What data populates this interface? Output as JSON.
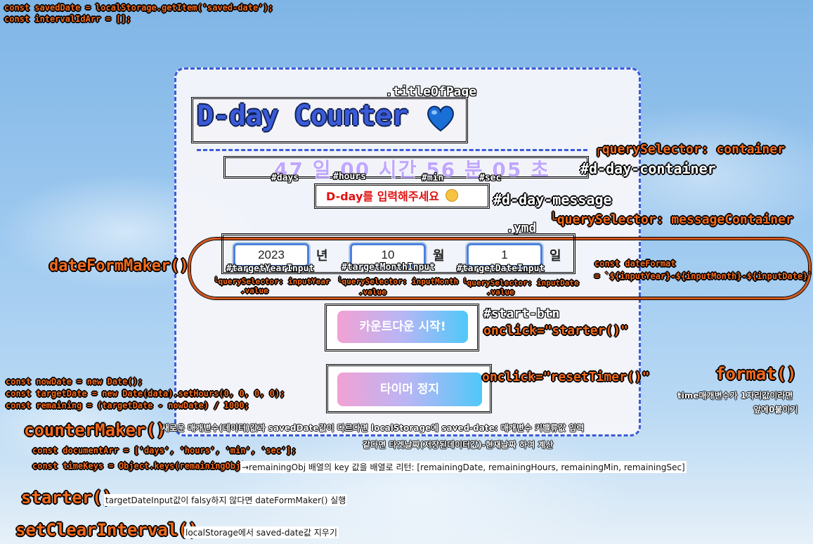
{
  "code": {
    "line1": "const savedDate = localStorage.getItem('saved-date');",
    "line2": "const intervalIdArr = [];",
    "now1": "const nowDate = new Date();",
    "now2": "const targetDate = new Date(data).setHours(0, 0, 0, 0);",
    "now3": "const remaining = (targetDate - nowDate) / 1000;",
    "doc1": "const documentArr = ['days', 'hours', 'min', 'sec'];",
    "doc2": "const timeKeys = Object.keys(remainingObj);"
  },
  "labels": {
    "title_of_page": ".titleOfPage",
    "query_container": "┌querySelector: container",
    "dday_container": "#d-day-container",
    "dday_message": "#d-day-message",
    "query_message": "└querySelector: messageContainer",
    "ymd": ".ymd",
    "days": "#days",
    "hours": "#hours",
    "min": "#min",
    "sec": "#sec",
    "target_year": "#targetYearInput",
    "target_month": "#targetMonthInput",
    "target_date": "#targetDateInput",
    "qs_year": "└querySelector: inputYear",
    "qs_month": "└querySelector: inputMonth",
    "qs_date": "└querySelector: inputDate",
    "value": ".value",
    "start_btn": "#start-btn",
    "onclick_starter": "onclick=\"starter()\"",
    "onclick_reset": "onclick=\"resetTimer()\""
  },
  "functions": {
    "date_form_maker": "dateFormMaker()",
    "counter_maker": "counterMaker()",
    "starter": "starter()",
    "set_clear_interval": "setClearInterval()",
    "format": "format()"
  },
  "notes": {
    "date_format_1": "const dateFormat",
    "date_format_2": "= `${inputYear}-${inputMonth}-${inputDate}`",
    "format_1": "time매개변수가 1자리값이라면",
    "format_2": "앞에0붙이기",
    "counter_1": "새로운 매개변수(데이터)값과 savedDate값이 다르다면 localStorage에 saved-date: 매개변수 키밸류값 입력",
    "counter_2": "같다면 타겟날짜(저장된데이터값)-현재날짜 하여 계산",
    "keys_note": "→remainingObj 배열의 key 값을 배열로 리턴: [remainingDate, remainingHours, remainingMin, remainingSec]",
    "starter_note": "targetDateInput값이 falsy하지 않다면 dateFormMaker() 실행",
    "clear_note": "localStorage에서 saved-date값 지우기"
  },
  "app": {
    "title": "D-day Counter",
    "dday_display": "47 일   00 시간   56 분   05 초",
    "message": "D-day를 입력해주세요",
    "year": "2023",
    "month": "10",
    "date": "1",
    "unit_year": "년",
    "unit_month": "월",
    "unit_date": "일",
    "start_button": "카운트다운 시작!",
    "stop_button": "타이머 정지"
  },
  "colors": {
    "accent": "#3a5bd9",
    "annotation": "#f56a1a",
    "message": "#e01010"
  },
  "icons": [
    "blue-heart-icon",
    "smile-emoji-icon"
  ]
}
